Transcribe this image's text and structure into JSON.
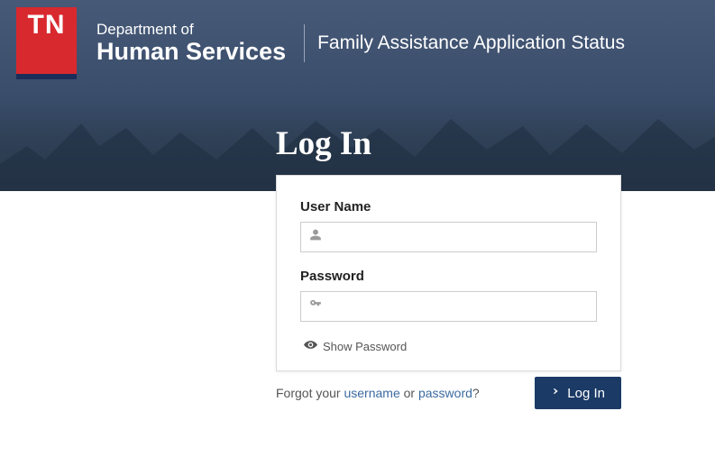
{
  "header": {
    "logo_mark": "TN",
    "dept_line": "Department of",
    "dept_name": "Human Services",
    "app_title": "Family Assistance Application Status"
  },
  "page": {
    "title": "Log In"
  },
  "form": {
    "username_label": "User Name",
    "password_label": "Password",
    "show_password_label": "Show Password"
  },
  "footer": {
    "forgot_prefix": "Forgot your ",
    "username_link": "username",
    "or_text": " or ",
    "password_link": "password",
    "suffix": "?",
    "login_button": "Log In"
  }
}
